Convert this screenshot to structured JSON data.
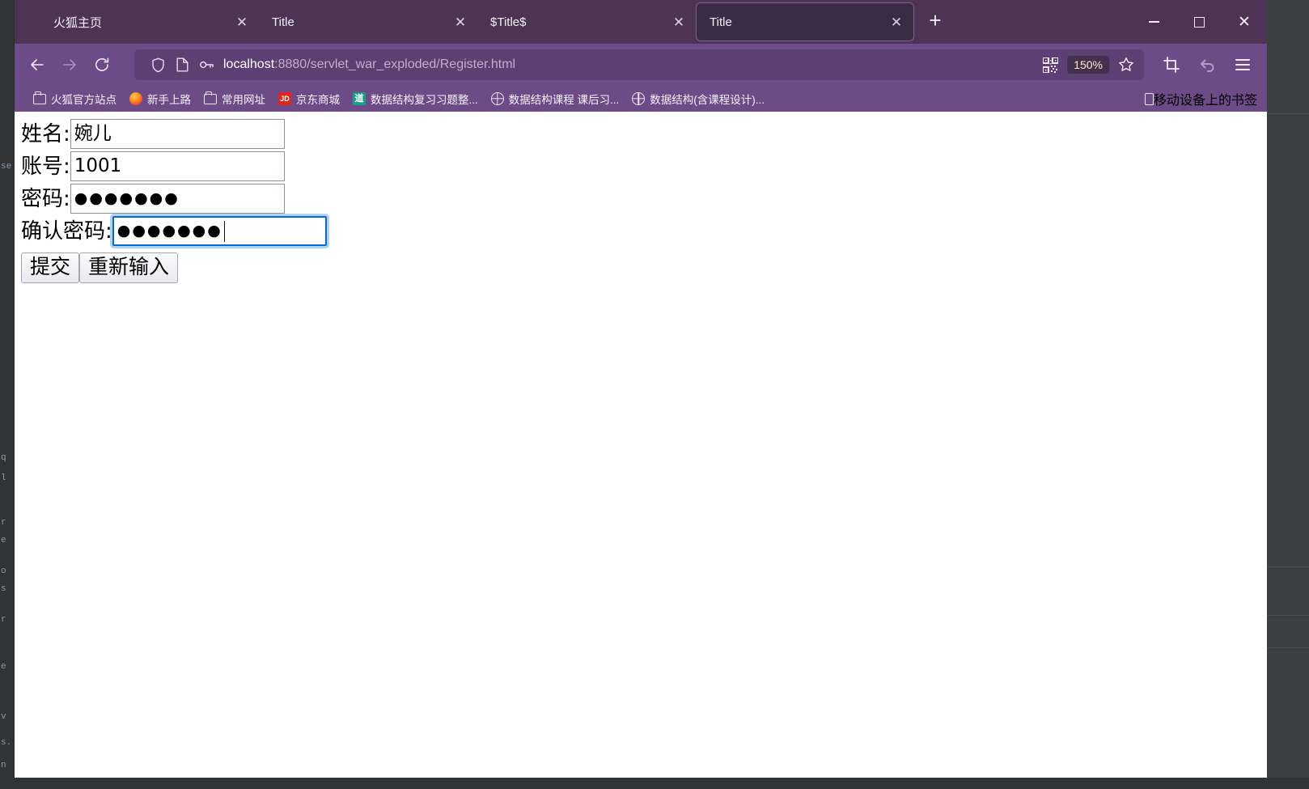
{
  "window": {
    "controls": {
      "minimize": "—",
      "maximize": "□",
      "close": "✕"
    }
  },
  "tabbar": {
    "new_tab_label": "+",
    "close_glyph": "✕",
    "tabs": [
      {
        "title": "火狐主页",
        "active": false
      },
      {
        "title": "Title",
        "active": false
      },
      {
        "title": "$Title$",
        "active": false
      },
      {
        "title": "Title",
        "active": true
      }
    ]
  },
  "toolbar": {
    "back_label": "Back",
    "forward_label": "Forward",
    "reload_label": "Reload",
    "url_host": "localhost",
    "url_path": ":8880/servlet_war_exploded/Register.html",
    "url_full": "localhost:8880/servlet_war_exploded/Register.html",
    "zoom_level": "150%",
    "qr_label": "QR code",
    "bookmark_star_label": "Bookmark this page",
    "screenshot_label": "Take screenshot",
    "undo_label": "Undo",
    "menu_label": "Open application menu"
  },
  "bookmarks": {
    "items": [
      {
        "label": "火狐官方站点",
        "icon": "folder-icon"
      },
      {
        "label": "新手上路",
        "icon": "firefox-icon"
      },
      {
        "label": "常用网址",
        "icon": "folder-icon"
      },
      {
        "label": "京东商城",
        "icon": "jd-icon",
        "icon_text": "JD"
      },
      {
        "label": "数据结构复习习题整...",
        "icon": "dao-icon",
        "icon_text": "道"
      },
      {
        "label": "数据结构课程 课后习...",
        "icon": "globe-icon"
      },
      {
        "label": "数据结构(含课程设计)...",
        "icon": "globe-icon"
      }
    ],
    "mobile": {
      "label": "移动设备上的书签",
      "icon": "phone-icon"
    }
  },
  "page": {
    "fields": [
      {
        "label": "姓名:",
        "value": "婉儿",
        "type": "text",
        "focused": false
      },
      {
        "label": "账号:",
        "value": "1001",
        "type": "text",
        "focused": false
      },
      {
        "label": "密码:",
        "value": "●●●●●●●",
        "type": "password",
        "focused": false
      },
      {
        "label": "确认密码:",
        "value": "●●●●●●●",
        "type": "password",
        "focused": true
      }
    ],
    "submit_label": "提交",
    "reset_label": "重新输入"
  },
  "colors": {
    "tabstrip": "#4d3455",
    "toolbar": "#6c4b86",
    "urlbar": "#5c3f73",
    "active_tab": "#3b2c45",
    "focus_blue": "#0b66d0",
    "focus_glow": "#aed4f5"
  }
}
